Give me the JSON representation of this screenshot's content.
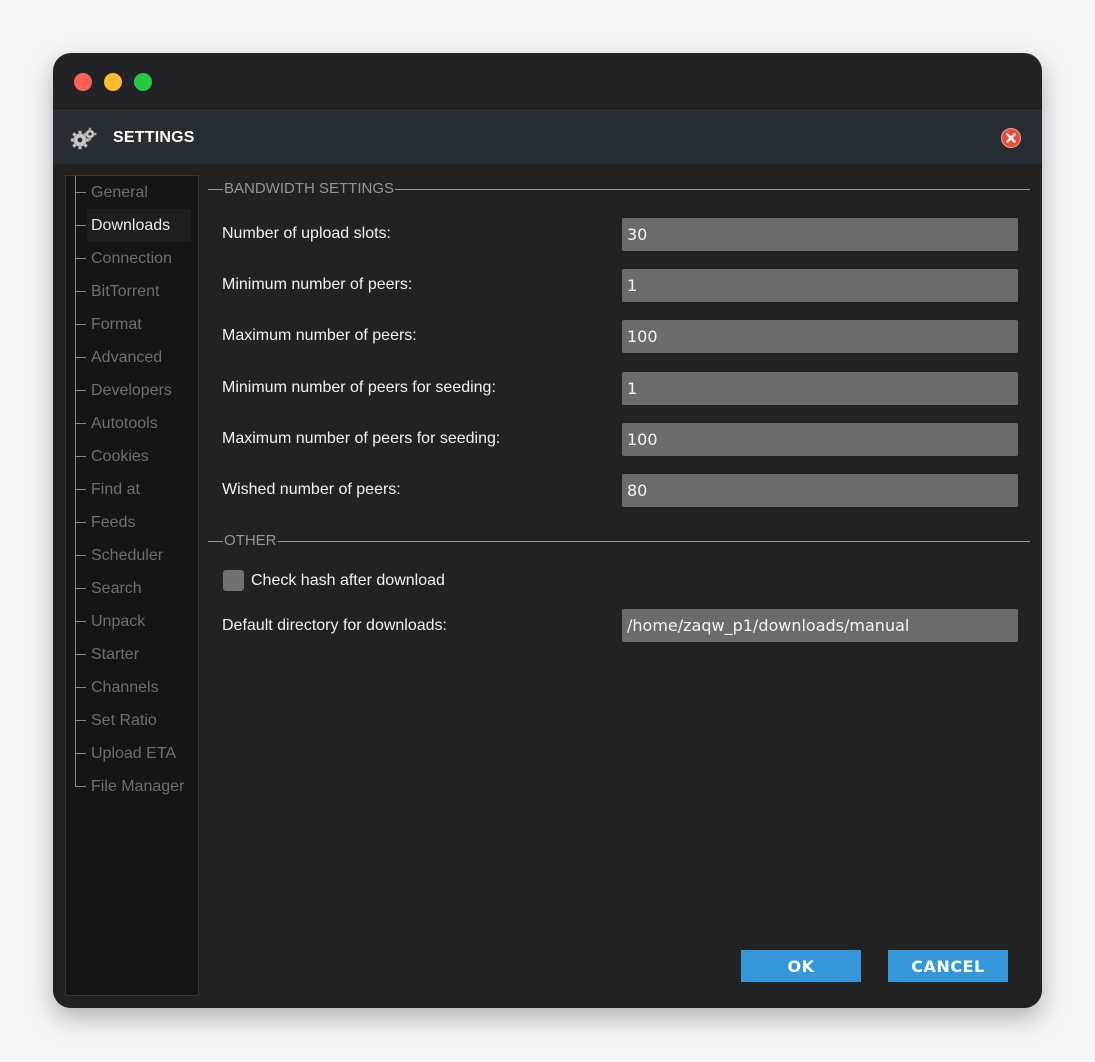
{
  "window": {
    "controls": {
      "close": "#fe5f57",
      "minimize": "#febc2e",
      "zoom": "#28c840"
    }
  },
  "dialog": {
    "title": "SETTINGS",
    "icon": "gears-icon",
    "close_icon": "close-circle-icon"
  },
  "sidebar": {
    "items": [
      {
        "label": "General"
      },
      {
        "label": "Downloads",
        "active": true
      },
      {
        "label": "Connection"
      },
      {
        "label": "BitTorrent"
      },
      {
        "label": "Format"
      },
      {
        "label": "Advanced"
      },
      {
        "label": "Developers"
      },
      {
        "label": "Autotools"
      },
      {
        "label": "Cookies"
      },
      {
        "label": "Find at"
      },
      {
        "label": "Feeds"
      },
      {
        "label": "Scheduler"
      },
      {
        "label": "Search"
      },
      {
        "label": "Unpack"
      },
      {
        "label": "Starter"
      },
      {
        "label": "Channels"
      },
      {
        "label": "Set Ratio"
      },
      {
        "label": "Upload ETA"
      },
      {
        "label": "File Manager"
      }
    ]
  },
  "bandwidth": {
    "title": "BANDWIDTH SETTINGS",
    "rows": [
      {
        "label": "Number of upload slots:",
        "value": "30"
      },
      {
        "label": "Minimum number of peers:",
        "value": "1"
      },
      {
        "label": "Maximum number of peers:",
        "value": "100"
      },
      {
        "label": "Minimum number of peers for seeding:",
        "value": "1"
      },
      {
        "label": "Maximum number of peers for seeding:",
        "value": "100"
      },
      {
        "label": "Wished number of peers:",
        "value": "80"
      }
    ]
  },
  "other": {
    "title": "OTHER",
    "check_hash_label": "Check hash after download",
    "check_hash_checked": false,
    "default_dir_label": "Default directory for downloads:",
    "default_dir_value": "/home/zaqw_p1/downloads/manual"
  },
  "buttons": {
    "ok": "OK",
    "cancel": "CANCEL"
  },
  "colors": {
    "accent": "#3497da",
    "titlebar": "#262e34",
    "close": "#e74c3c"
  }
}
